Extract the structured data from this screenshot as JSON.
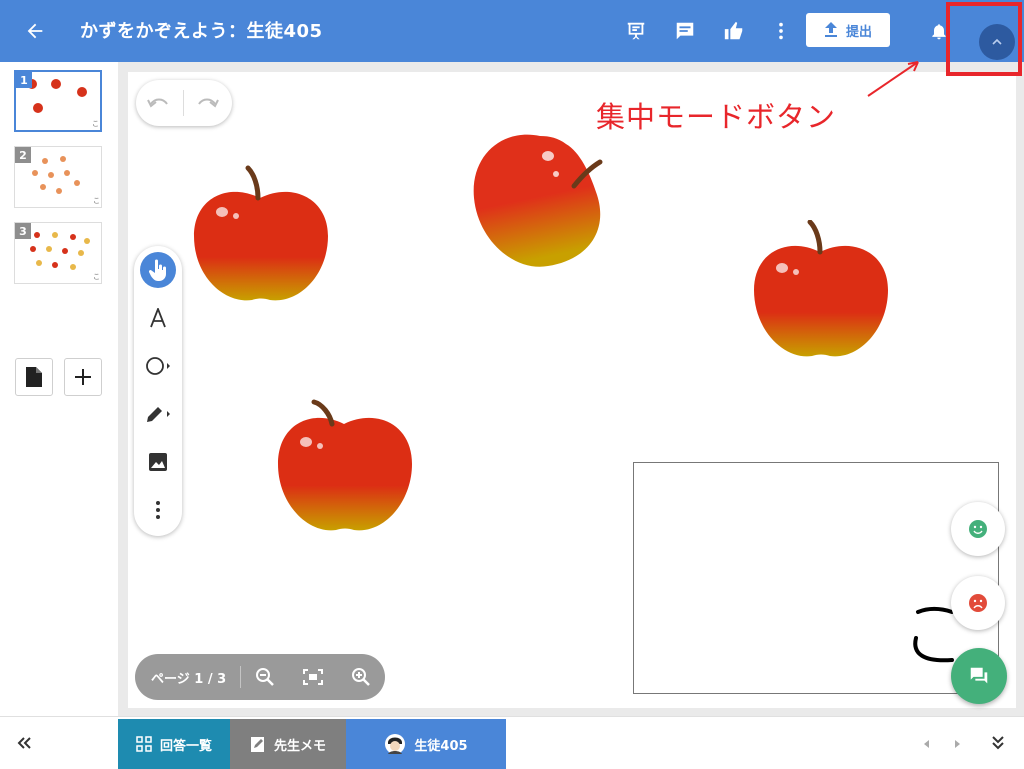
{
  "header": {
    "back_icon": "arrow-left-icon",
    "title": "かずをかぞえよう：生徒405",
    "submit_label": "提出",
    "icons": [
      "presentation-icon",
      "comment-icon",
      "thumbs-up-icon",
      "more-vert-icon",
      "bell-icon",
      "chevron-up-icon"
    ]
  },
  "annotation": {
    "label": "集中モードボタン",
    "color": "#e8262b"
  },
  "sidebar": {
    "pages": [
      {
        "number": "1",
        "active": true
      },
      {
        "number": "2",
        "active": false
      },
      {
        "number": "3",
        "active": false
      }
    ],
    "add_page_icon": "file-icon",
    "add_icon": "plus-icon"
  },
  "toolbar": {
    "tools": [
      "hand-pointer-icon",
      "text-tool-icon",
      "shape-tool-icon",
      "pen-tool-icon",
      "image-tool-icon",
      "more-vert-icon"
    ]
  },
  "zoom": {
    "page_label": "ページ 1 / 3"
  },
  "bottom": {
    "collapse_icon": "double-chevron-left-icon",
    "tabs": [
      {
        "label": "回答一覧",
        "color": "#1e8bb0"
      },
      {
        "label": "先生メモ",
        "color": "#7f7f7f"
      },
      {
        "label": "生徒405",
        "color": "#4a86d8"
      }
    ],
    "right_icons": [
      "prev-icon",
      "next-icon",
      "double-chevron-down-icon"
    ]
  },
  "colors": {
    "primary": "#4a86d8",
    "fab_green": "#44b07b",
    "highlight_red": "#e8262b"
  }
}
